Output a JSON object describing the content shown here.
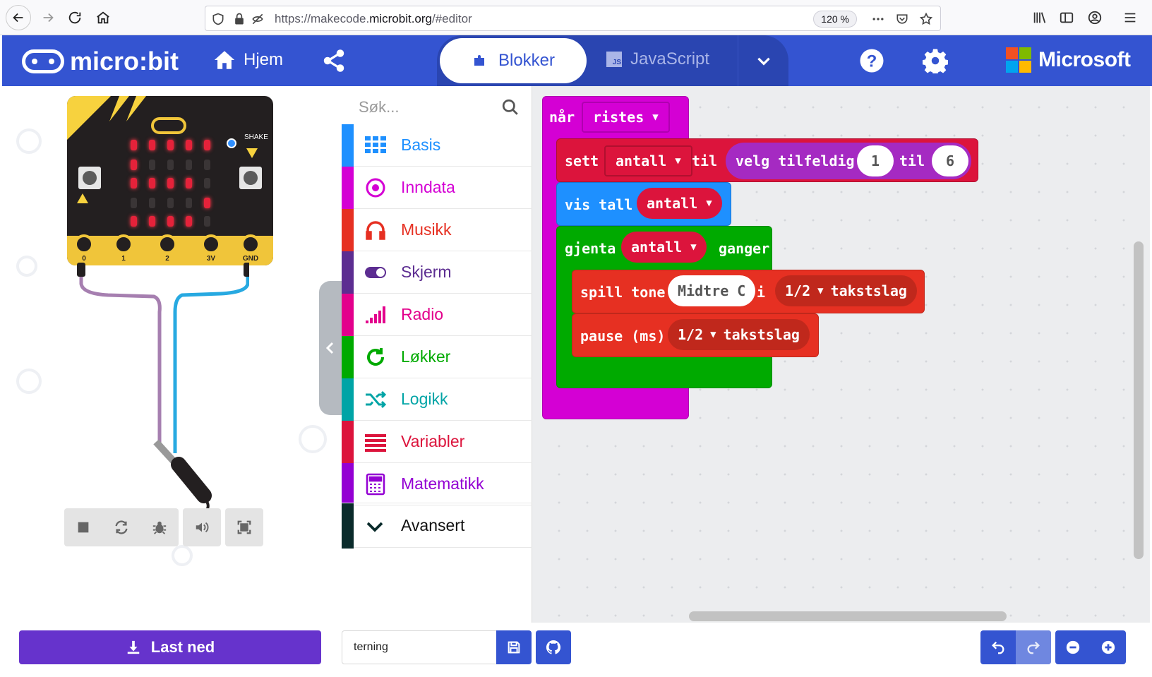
{
  "browser": {
    "url_prefix": "https://makecode.",
    "url_domain": "microbit.org",
    "url_suffix": "/#editor",
    "zoom": "120 %"
  },
  "header": {
    "brand": "micro:bit",
    "home_label": "Hjem",
    "mode_blocks": "Blokker",
    "mode_js": "JavaScript",
    "ms_brand": "Microsoft",
    "ms_colors": [
      "#f25022",
      "#7fba00",
      "#00a4ef",
      "#ffb900"
    ]
  },
  "simulator": {
    "shake_label": "SHAKE",
    "pins": [
      "0",
      "1",
      "2",
      "3V",
      "GND"
    ],
    "led_grid": [
      [
        1,
        1,
        1,
        1,
        1
      ],
      [
        1,
        0,
        0,
        0,
        0
      ],
      [
        1,
        1,
        1,
        1,
        0
      ],
      [
        0,
        0,
        0,
        0,
        1
      ],
      [
        1,
        1,
        1,
        1,
        0
      ]
    ]
  },
  "toolbox": {
    "search_placeholder": "Søk...",
    "categories": [
      {
        "label": "Basis",
        "color": "#1e90ff",
        "icon": "grid-icon"
      },
      {
        "label": "Inndata",
        "color": "#d400d4",
        "icon": "target-icon"
      },
      {
        "label": "Musikk",
        "color": "#e63022",
        "icon": "headphones-icon"
      },
      {
        "label": "Skjerm",
        "color": "#5c2d91",
        "icon": "toggle-icon"
      },
      {
        "label": "Radio",
        "color": "#e3008c",
        "icon": "signal-icon"
      },
      {
        "label": "Løkker",
        "color": "#00aa00",
        "icon": "loop-icon"
      },
      {
        "label": "Logikk",
        "color": "#00a4a6",
        "icon": "shuffle-icon"
      },
      {
        "label": "Variabler",
        "color": "#dc143c",
        "icon": "lines-icon"
      },
      {
        "label": "Matematikk",
        "color": "#9400d3",
        "icon": "calculator-icon"
      }
    ],
    "advanced": {
      "label": "Avansert",
      "color": "#0a2b2b"
    }
  },
  "blocks": {
    "event": {
      "kw": "når",
      "dropdown": "ristes",
      "color": "#d400d4"
    },
    "set": {
      "kw1": "sett",
      "var": "antall",
      "kw2": "til",
      "func": "velg tilfeldig",
      "a": "1",
      "kw3": "til",
      "b": "6",
      "color": "#dc143c",
      "func_color": "#a52ac2"
    },
    "show": {
      "kw": "vis tall",
      "var": "antall",
      "color": "#1e90ff"
    },
    "repeat": {
      "kw1": "gjenta",
      "var": "antall",
      "kw2": "ganger",
      "color": "#00aa00"
    },
    "tone": {
      "kw1": "spill tone",
      "note": "Midtre C",
      "kw2": "i",
      "beat": "1/2",
      "beat_label": "takstslag",
      "color": "#e63022"
    },
    "pause": {
      "kw": "pause (ms)",
      "beat": "1/2",
      "beat_label": "takstslag",
      "color": "#e63022"
    }
  },
  "bottom": {
    "download_label": "Last ned",
    "project_name": "terning"
  }
}
